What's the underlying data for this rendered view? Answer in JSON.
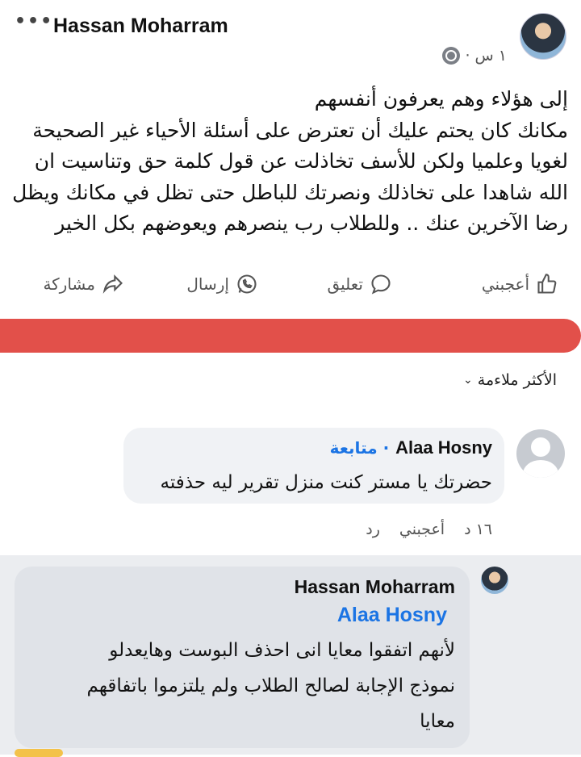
{
  "post": {
    "more_label": "•••",
    "author": "Hassan Moharram",
    "time": "١ س ·",
    "lines": [
      "إلى هؤلاء وهم يعرفون أنفسهم",
      "مكانك كان يحتم عليك أن تعترض على أسئلة الأحياء غير الصحيحة",
      "لغويا وعلميا ولكن للأسف تخاذلت عن قول كلمة حق وتناسيت ان",
      "الله شاهدا على تخاذلك ونصرتك للباطل حتى تظل في مكانك ويظل",
      "رضا الآخرين عنك .. وللطلاب رب ينصرهم ويعوضهم بكل الخير"
    ]
  },
  "actions": {
    "like": "أعجبني",
    "comment": "تعليق",
    "send": "إرسال",
    "share": "مشاركة"
  },
  "sort_label": "الأكثر ملاءمة",
  "comment": {
    "author": "Alaa Hosny",
    "follow": "· متابعة",
    "text": "حضرتك يا مستر كنت منزل تقرير ليه حذفته",
    "time": "١٦ د",
    "like": "أعجبني",
    "reply": "رد"
  },
  "reply": {
    "author": "Hassan Moharram",
    "mention": "Alaa Hosny",
    "lines": [
      "لأنهم اتفقوا معايا انى احذف البوست وهايعدلو",
      "نموذج الإجابة لصالح الطلاب ولم يلتزموا باتفاقهم",
      "معايا"
    ]
  },
  "colors": {
    "accent": "#1b74e4",
    "highlight_bar": "#e2504a"
  }
}
